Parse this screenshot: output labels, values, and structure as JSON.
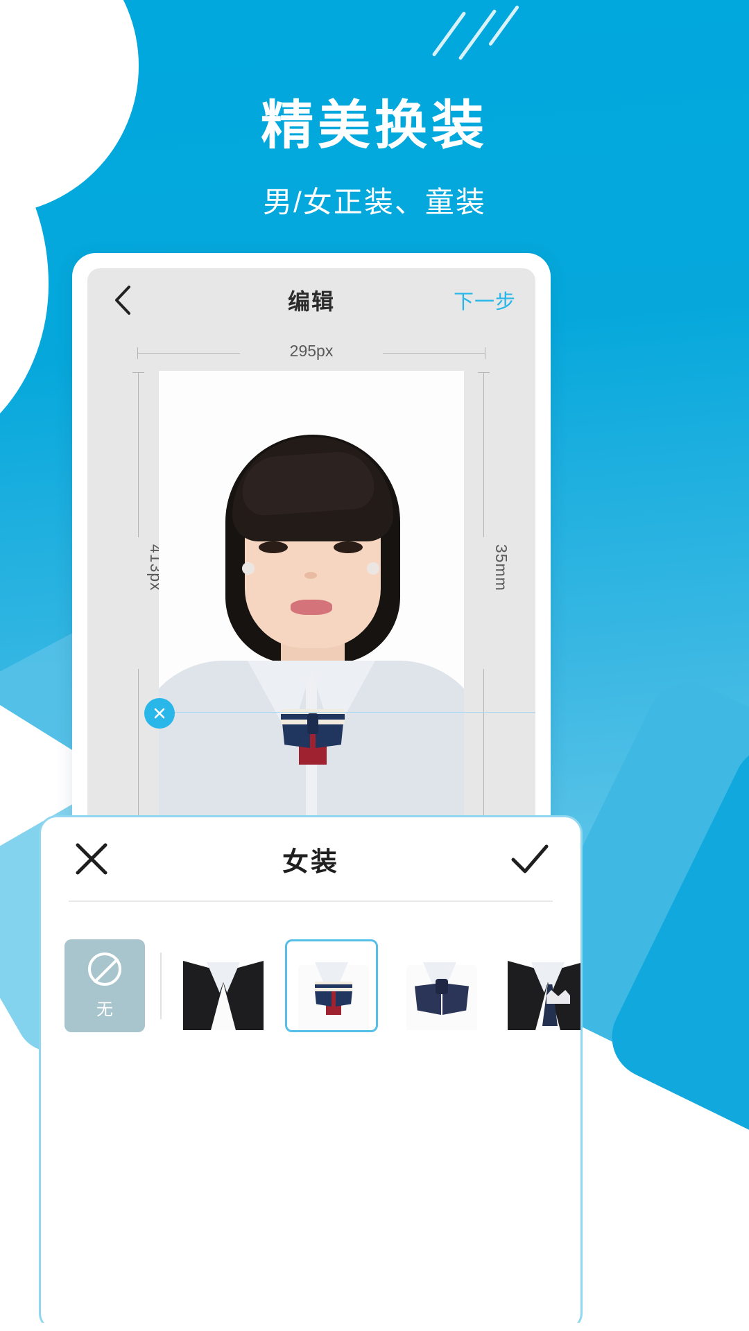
{
  "promo": {
    "headline": "精美换装",
    "subheadline": "男/女正装、童装"
  },
  "colors": {
    "brand_blue": "#00a8dd",
    "accent_cyan": "#29b6e8",
    "screen_gray": "#e7e7e7",
    "sheet_border": "#8fd6f0",
    "text_dark": "#2b2b2b"
  },
  "app": {
    "navbar": {
      "back_icon": "chevron-left-icon",
      "title": "编辑",
      "next_label": "下一步"
    },
    "editor": {
      "width_label": "295px",
      "height_label": "413px",
      "print_height_label": "35mm",
      "delete_icon": "close-circle-icon"
    },
    "sheet": {
      "close_icon": "close-icon",
      "title": "女装",
      "confirm_icon": "check-icon",
      "options": [
        {
          "id": "none",
          "label": "无",
          "icon": "no-entry-icon",
          "selected": false
        },
        {
          "id": "black-suit-white-shirt",
          "label": "",
          "selected": false
        },
        {
          "id": "white-shirt-striped-bowtie",
          "label": "",
          "selected": true
        },
        {
          "id": "white-shirt-navy-ribbon",
          "label": "",
          "selected": false
        },
        {
          "id": "black-suit-pocket-square",
          "label": "",
          "selected": false
        }
      ]
    }
  }
}
